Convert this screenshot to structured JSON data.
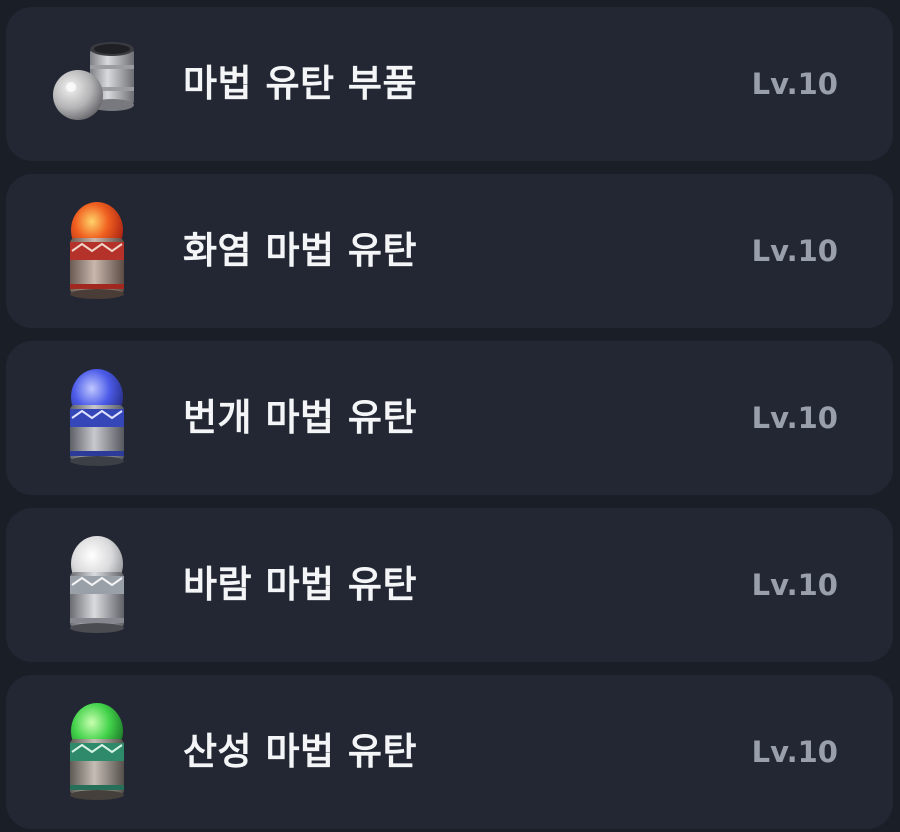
{
  "items": [
    {
      "name": "마법 유탄 부품",
      "level": "Lv.10",
      "icon": "magic-grenade-parts-icon",
      "orb_color": "#c9c9c9"
    },
    {
      "name": "화염 마법 유탄",
      "level": "Lv.10",
      "icon": "fire-magic-grenade-icon",
      "orb_color": "#e8461e",
      "band_color": "#b5322a"
    },
    {
      "name": "번개 마법 유탄",
      "level": "Lv.10",
      "icon": "lightning-magic-grenade-icon",
      "orb_color": "#4b5be8",
      "band_color": "#3446b8"
    },
    {
      "name": "바람 마법 유탄",
      "level": "Lv.10",
      "icon": "wind-magic-grenade-icon",
      "orb_color": "#e6e6e6",
      "band_color": "#9aa0a8"
    },
    {
      "name": "산성 마법 유탄",
      "level": "Lv.10",
      "icon": "acid-magic-grenade-icon",
      "orb_color": "#42d24a",
      "band_color": "#2f8a6c"
    }
  ]
}
